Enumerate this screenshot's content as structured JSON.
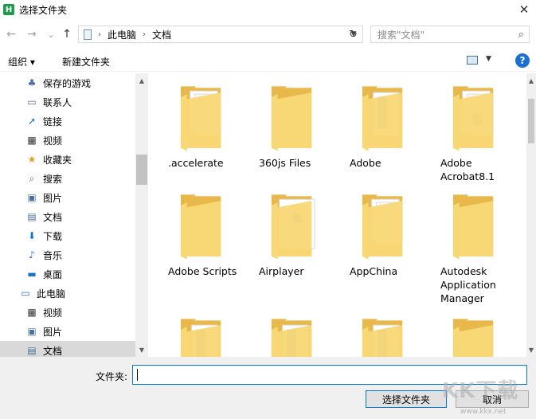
{
  "window": {
    "title": "选择文件夹",
    "app_icon_letter": "H",
    "close_glyph": "✕"
  },
  "nav": {
    "back_glyph": "←",
    "forward_glyph": "→",
    "recent_glyph": "⌄",
    "up_glyph": "↑",
    "breadcrumbs": [
      "此电脑",
      "文档"
    ],
    "crumb_sep": "›",
    "refresh_glyph": "↻",
    "search_placeholder": "搜索\"文档\"",
    "search_glyph": "⌕"
  },
  "toolbar": {
    "organize": "组织 ▾",
    "new_folder": "新建文件夹",
    "help": "?"
  },
  "sidebar": {
    "items": [
      {
        "label": "保存的游戏",
        "icon": "saved-games-icon",
        "glyph": "♣",
        "color": "#4a6f9a",
        "indent": 1
      },
      {
        "label": "联系人",
        "icon": "contacts-icon",
        "glyph": "▭",
        "color": "#4a6f9a",
        "indent": 1
      },
      {
        "label": "链接",
        "icon": "links-icon",
        "glyph": "➚",
        "color": "#1a6fd4",
        "indent": 1
      },
      {
        "label": "视频",
        "icon": "video-icon",
        "glyph": "▦",
        "color": "#333333",
        "indent": 1
      },
      {
        "label": "收藏夹",
        "icon": "favorites-icon",
        "glyph": "★",
        "color": "#e0a020",
        "indent": 1
      },
      {
        "label": "搜索",
        "icon": "search-icon",
        "glyph": "⌕",
        "color": "#4a6f9a",
        "indent": 1
      },
      {
        "label": "图片",
        "icon": "pictures-icon",
        "glyph": "▣",
        "color": "#4a6f9a",
        "indent": 1
      },
      {
        "label": "文档",
        "icon": "documents-icon",
        "glyph": "▤",
        "color": "#4a6f9a",
        "indent": 1
      },
      {
        "label": "下载",
        "icon": "downloads-icon",
        "glyph": "⬇",
        "color": "#1a6fd4",
        "indent": 1
      },
      {
        "label": "音乐",
        "icon": "music-icon",
        "glyph": "♪",
        "color": "#1a6fd4",
        "indent": 1
      },
      {
        "label": "桌面",
        "icon": "desktop-icon",
        "glyph": "▬",
        "color": "#1a6fd4",
        "indent": 1
      },
      {
        "label": "此电脑",
        "icon": "this-pc-icon",
        "glyph": "▭",
        "color": "#1a6fd4",
        "indent": 0
      },
      {
        "label": "视频",
        "icon": "video-icon",
        "glyph": "▦",
        "color": "#333333",
        "indent": 1
      },
      {
        "label": "图片",
        "icon": "pictures-icon",
        "glyph": "▣",
        "color": "#4a6f9a",
        "indent": 1
      },
      {
        "label": "文档",
        "icon": "documents-icon",
        "glyph": "▤",
        "color": "#4a6f9a",
        "indent": 1,
        "selected": true
      }
    ]
  },
  "folders": [
    {
      "name": ".accelerate",
      "variant": "papers"
    },
    {
      "name": "360js Files",
      "variant": "plain"
    },
    {
      "name": "Adobe",
      "variant": "blue-doc"
    },
    {
      "name": "Adobe Acrobat8.1",
      "variant": "papers-img"
    },
    {
      "name": "Adobe Scripts",
      "variant": "plain"
    },
    {
      "name": "Airplayer",
      "variant": "white-page"
    },
    {
      "name": "AppChina",
      "variant": "papers"
    },
    {
      "name": "Autodesk Application Manager",
      "variant": "plain"
    },
    {
      "name": "",
      "variant": "blue-doc"
    },
    {
      "name": "",
      "variant": "blue-doc"
    },
    {
      "name": "",
      "variant": "blue-doc"
    },
    {
      "name": "",
      "variant": "plain"
    }
  ],
  "footer": {
    "filename_label": "文件夹:",
    "filename_value": "",
    "select_button": "选择文件夹",
    "cancel_button": "取消"
  },
  "watermark": {
    "text": "KK下载",
    "url": "www.kkx.net"
  },
  "colors": {
    "accent": "#0078d7",
    "folder": "#f8d775",
    "folder_dark": "#e8b94a",
    "selection": "#d9d9d9"
  }
}
